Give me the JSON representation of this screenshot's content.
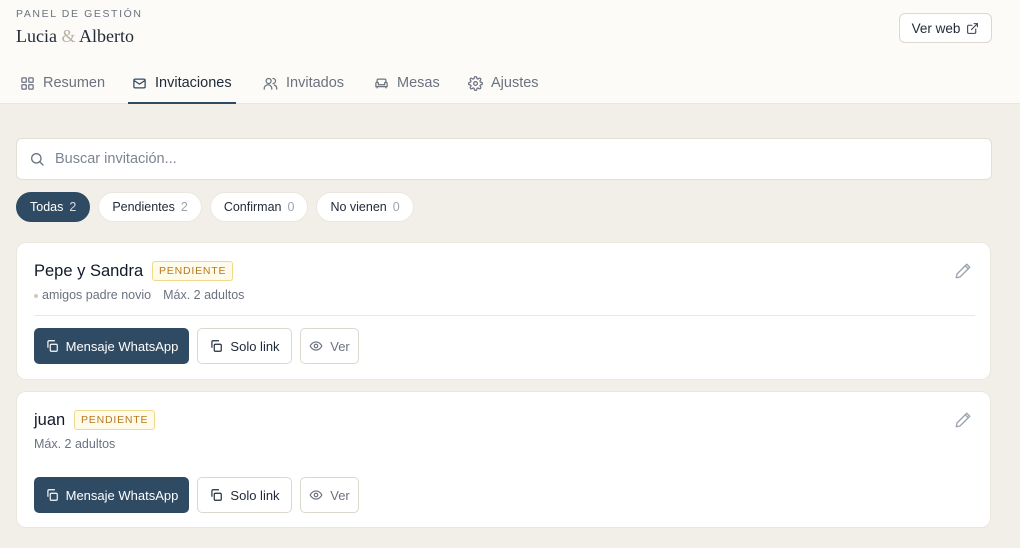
{
  "header": {
    "eyebrow": "PANEL DE GESTIÓN",
    "couple": {
      "first": "Lucia",
      "amp": "&",
      "second": "Alberto"
    },
    "ver_web_label": "Ver web"
  },
  "tabs": [
    {
      "label": "Resumen",
      "icon": "grid-icon",
      "active": false
    },
    {
      "label": "Invitaciones",
      "icon": "mail-icon",
      "active": true
    },
    {
      "label": "Invitados",
      "icon": "users-icon",
      "active": false
    },
    {
      "label": "Mesas",
      "icon": "sofa-icon",
      "active": false
    },
    {
      "label": "Ajustes",
      "icon": "gear-icon",
      "active": false
    }
  ],
  "search": {
    "placeholder": "Buscar invitación...",
    "value": ""
  },
  "filters": [
    {
      "label": "Todas",
      "count": "2",
      "active": true
    },
    {
      "label": "Pendientes",
      "count": "2",
      "active": false
    },
    {
      "label": "Confirman",
      "count": "0",
      "active": false
    },
    {
      "label": "No vienen",
      "count": "0",
      "active": false
    }
  ],
  "invitations": [
    {
      "name": "Pepe y Sandra",
      "status": "PENDIENTE",
      "group": "amigos padre novio",
      "max": "Máx. 2 adultos"
    },
    {
      "name": "juan",
      "status": "PENDIENTE",
      "group": "",
      "max": "Máx. 2 adultos"
    }
  ],
  "actions": {
    "whatsapp": "Mensaje WhatsApp",
    "link": "Solo link",
    "view": "Ver"
  },
  "colors": {
    "accent": "#2f4a63",
    "background": "#f2efe9",
    "badge_text": "#b7791f",
    "badge_bg": "#fffbea"
  }
}
